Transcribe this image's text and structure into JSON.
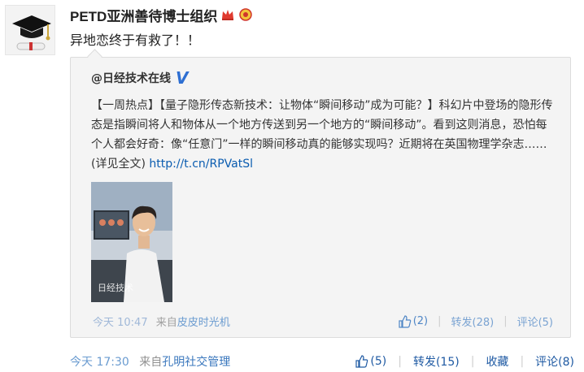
{
  "post": {
    "author": "PETD亚洲善待博士组织",
    "text": "异地恋终于有救了！！",
    "time": "今天 17:30",
    "source_prefix": "来自",
    "source": "孔明社交管理",
    "actions": {
      "like_count": "(5)",
      "repost_label": "转发(15)",
      "favorite_label": "收藏",
      "comment_label": "评论(8)",
      "separator": "|"
    }
  },
  "quoted": {
    "author": "@日经技术在线",
    "verified_mark": "V",
    "text": "【一周热点】【量子隐形传态新技术：让物体“瞬间移动”成为可能？】科幻片中登场的隐形传态是指瞬间将人和物体从一个地方传送到另一个地方的“瞬间移动”。看到这则消息，恐怕每个人都会好奇：像“任意门”一样的瞬间移动真的能够实现吗？近期将在英国物理学杂志……(详见全文) ",
    "link": "http://t.cn/RPVatSl",
    "image_watermark": "日经技术",
    "time": "今天 10:47",
    "source_prefix": "来自",
    "source": "皮皮时光机",
    "actions": {
      "like_count": "(2)",
      "repost_label": "转发(28)",
      "comment_label": "评论(5)",
      "separator": "|"
    }
  },
  "icons": {
    "avatar": "graduation-cap",
    "badge1": "crown-icon",
    "badge2": "ribbon-icon",
    "like": "thumb-up-icon",
    "verified": "v-verified-icon"
  },
  "colors": {
    "link": "#0a5cb0",
    "verified": "#2e6fd2",
    "muted": "#909090"
  }
}
